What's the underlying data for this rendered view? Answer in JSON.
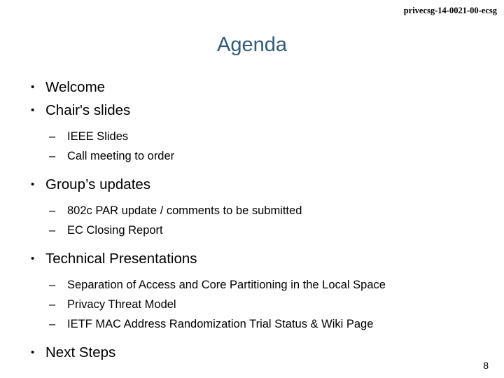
{
  "slide": {
    "header": "privecsg-14-0021-00-ecsg",
    "title": "Agenda",
    "page_number": "8",
    "title_color": "#2E5A7D",
    "text_color": "#000000",
    "background_color": "#FFFFFF",
    "bullet_marker_level1": "•",
    "bullet_marker_level2": "–",
    "outline": [
      {
        "level": 1,
        "text": "Welcome"
      },
      {
        "level": 1,
        "text": "Chair's slides"
      },
      {
        "level": 2,
        "text": "IEEE Slides"
      },
      {
        "level": 2,
        "text": "Call meeting to order"
      },
      {
        "level": 1,
        "text": "Group’s updates"
      },
      {
        "level": 2,
        "text": "802c PAR update / comments to be submitted"
      },
      {
        "level": 2,
        "text": "EC Closing Report"
      },
      {
        "level": 1,
        "text": "Technical Presentations"
      },
      {
        "level": 2,
        "text": "Separation of Access and Core Partitioning in the Local Space"
      },
      {
        "level": 2,
        "text": "Privacy Threat Model"
      },
      {
        "level": 2,
        "text": "IETF MAC Address Randomization Trial Status & Wiki Page"
      },
      {
        "level": 1,
        "text": "Next Steps"
      }
    ]
  }
}
